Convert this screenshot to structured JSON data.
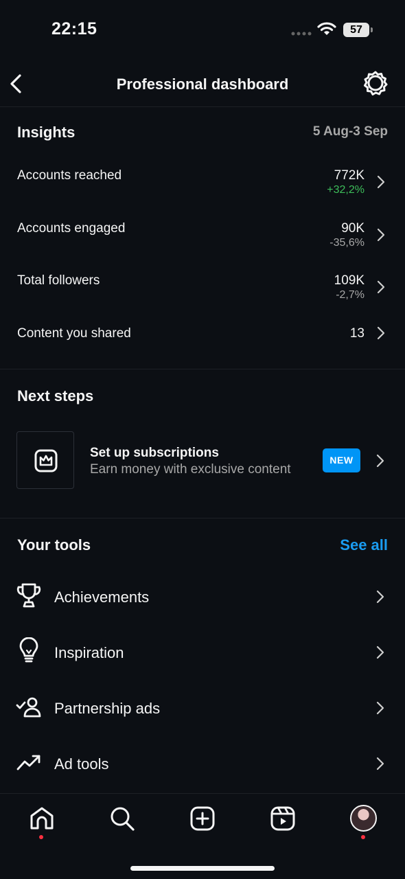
{
  "status_bar": {
    "time": "22:15",
    "battery": "57"
  },
  "header": {
    "title": "Professional dashboard"
  },
  "insights": {
    "title": "Insights",
    "date_range": "5 Aug-3 Sep",
    "metrics": [
      {
        "label": "Accounts reached",
        "value": "772K",
        "change": "+32,2%"
      },
      {
        "label": "Accounts engaged",
        "value": "90K",
        "change": "-35,6%"
      },
      {
        "label": "Total followers",
        "value": "109K",
        "change": "-2,7%"
      },
      {
        "label": "Content you shared",
        "value": "13",
        "change": ""
      }
    ]
  },
  "next_steps": {
    "title": "Next steps",
    "card": {
      "title": "Set up subscriptions",
      "description": "Earn money with exclusive content",
      "badge": "NEW",
      "icon": "crown-icon"
    }
  },
  "tools": {
    "title": "Your tools",
    "see_all": "See all",
    "items": [
      {
        "label": "Achievements",
        "icon": "trophy-icon"
      },
      {
        "label": "Inspiration",
        "icon": "lightbulb-icon"
      },
      {
        "label": "Partnership ads",
        "icon": "partnership-icon"
      },
      {
        "label": "Ad tools",
        "icon": "trending-up-icon"
      }
    ]
  },
  "tab_bar": {
    "items": [
      "home-icon",
      "search-icon",
      "create-icon",
      "reels-icon",
      "profile-avatar"
    ]
  },
  "colors": {
    "background": "#0c0f14",
    "accent": "#0095f6",
    "positive": "#3dbd5a",
    "notification_dot": "#ff3040"
  }
}
